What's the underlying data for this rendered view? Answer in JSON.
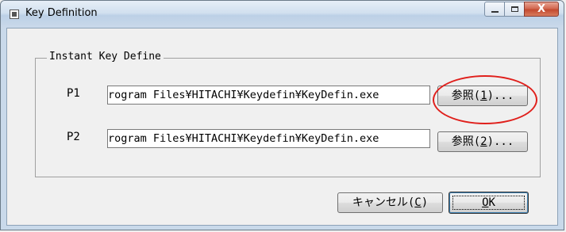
{
  "window": {
    "title": "Key Definition",
    "close_glyph": "X"
  },
  "group": {
    "legend": "Instant Key Define"
  },
  "rows": [
    {
      "label": "P1",
      "value": "C:\\Program Files\\HITACHI¥Keydefin¥KeyDefin.exe",
      "visible_value": "rogram Files¥HITACHI¥Keydefin¥KeyDefin.exe",
      "browse_prefix": "参照(",
      "browse_key": "1",
      "browse_suffix": ")..."
    },
    {
      "label": "P2",
      "value": "C:\\Program Files\\HITACHI¥Keydefin¥KeyDefin.exe",
      "visible_value": "rogram Files¥HITACHI¥Keydefin¥KeyDefin.exe",
      "browse_prefix": "参照(",
      "browse_key": "2",
      "browse_suffix": ")..."
    }
  ],
  "buttons": {
    "cancel_prefix": "キャンセル(",
    "cancel_key": "C",
    "cancel_suffix": ")",
    "ok_key": "O",
    "ok_rest": "K"
  },
  "colors": {
    "highlight": "#e0201c"
  }
}
